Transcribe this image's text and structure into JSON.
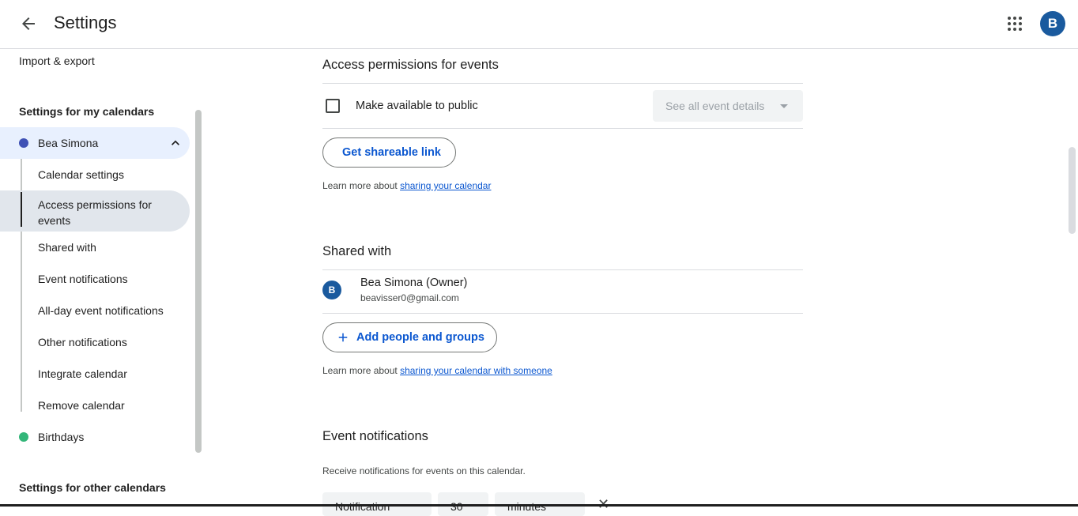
{
  "header": {
    "title": "Settings",
    "back_icon": "arrow-back-icon",
    "apps_icon": "apps-grid-icon",
    "avatar_letter": "B"
  },
  "sidebar": {
    "import_export": "Import & export",
    "my_calendars_heading": "Settings for my calendars",
    "calendar_name": "Bea Simona",
    "calendar_color": "#3f51b5",
    "items": [
      {
        "label": "Calendar settings",
        "active": false
      },
      {
        "label": "Access permissions for events",
        "active": true
      },
      {
        "label": "Shared with",
        "active": false
      },
      {
        "label": "Event notifications",
        "active": false
      },
      {
        "label": "All-day event notifications",
        "active": false
      },
      {
        "label": "Other notifications",
        "active": false
      },
      {
        "label": "Integrate calendar",
        "active": false
      },
      {
        "label": "Remove calendar",
        "active": false
      }
    ],
    "birthdays": "Birthdays",
    "birthdays_color": "#33b679",
    "other_calendars_heading": "Settings for other calendars"
  },
  "access": {
    "title": "Access permissions for events",
    "public_label": "Make available to public",
    "public_checked": false,
    "select_value": "See all event details",
    "share_button": "Get shareable link",
    "help_prefix": "Learn more about ",
    "help_link": "sharing your calendar"
  },
  "shared": {
    "title": "Shared with",
    "user_initial": "B",
    "user_name": "Bea Simona (Owner)",
    "user_email": "beavisser0@gmail.com",
    "add_button": "Add people and groups",
    "help_prefix": "Learn more about ",
    "help_link": "sharing your calendar with someone"
  },
  "notifications": {
    "title": "Event notifications",
    "description": "Receive notifications for events on this calendar.",
    "chip_1": "Notification",
    "chip_2": "30",
    "chip_3": "minutes"
  },
  "colors": {
    "accent": "#0b57d0",
    "avatar": "#1a5a9e",
    "selected_bg": "#e8f0fe",
    "active_bg": "#e1e6ec"
  }
}
